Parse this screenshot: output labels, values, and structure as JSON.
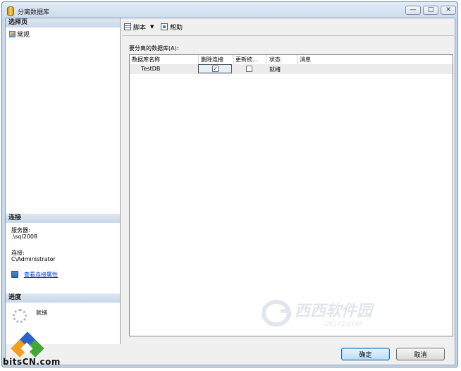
{
  "window": {
    "title": "分离数据库",
    "minimize_glyph": "—",
    "maximize_glyph": "□",
    "close_glyph": "✕"
  },
  "left_pane": {
    "select_page_header": "选择页",
    "pages": [
      {
        "label": "常规",
        "icon": "general-page-icon"
      }
    ],
    "connection_header": "连接",
    "server_label": "服务器:",
    "server_value": ".\\sql2008",
    "connection_label": "连接:",
    "connection_value": "C\\Administrator",
    "view_connection_properties": "查看连接属性",
    "progress_header": "进度",
    "progress_status": "就绪"
  },
  "toolbar": {
    "script_label": "脚本",
    "script_dropdown_glyph": "▼",
    "help_label": "帮助"
  },
  "grid": {
    "caption": "要分离的数据库(A):",
    "columns": [
      "数据库名称",
      "删除连接",
      "更新统...",
      "状态",
      "消息"
    ],
    "rows": [
      {
        "name": "TestDB",
        "drop_connections": true,
        "update_statistics": false,
        "status": "就绪",
        "message": ""
      }
    ],
    "checked_glyph": "✓"
  },
  "buttons": {
    "ok": "确定",
    "cancel": "取消"
  },
  "watermark": {
    "site_text": "西西软件园",
    "site_subtext": "CR173.COM"
  },
  "corner_logo": {
    "text": "bitsCN.com"
  },
  "colors": {
    "title_gradient_top": "#e2ecf7",
    "section_header": "#c9d7e8",
    "link": "#0033cc",
    "ok_border": "#2a6fb0"
  }
}
